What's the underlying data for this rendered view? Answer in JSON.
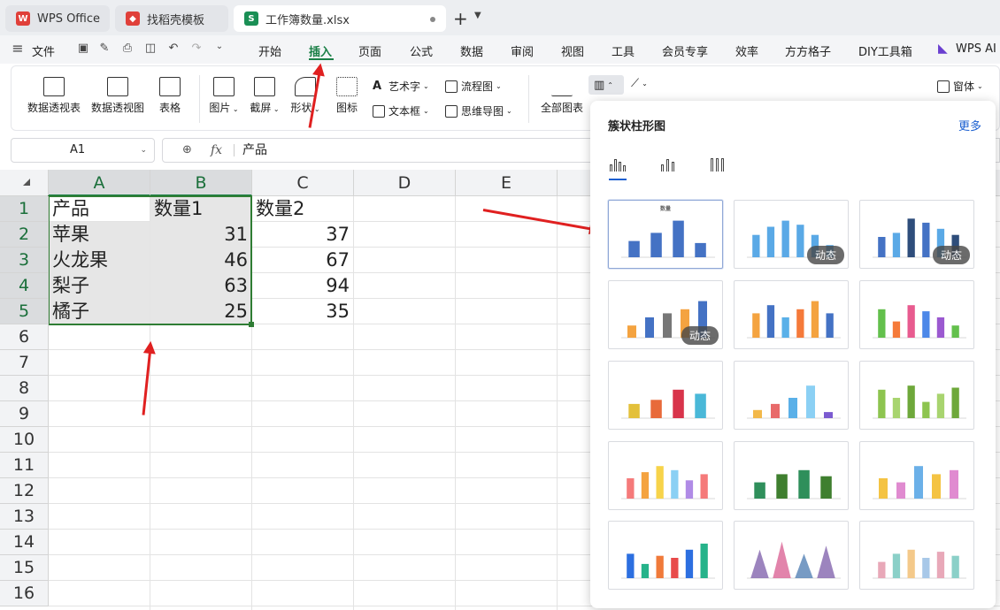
{
  "tabs": [
    {
      "label": "WPS Office",
      "icon": "wps-logo-icon",
      "color": "#e0403a"
    },
    {
      "label": "找稻壳模板",
      "icon": "docer-logo-icon",
      "color": "#e0403a"
    },
    {
      "label": "工作簿数量.xlsx",
      "icon": "sheet-file-icon",
      "color": "#1a8f55"
    }
  ],
  "menu": {
    "file": "文件",
    "items": [
      "开始",
      "插入",
      "页面",
      "公式",
      "数据",
      "审阅",
      "视图",
      "工具",
      "会员专享",
      "效率",
      "方方格子",
      "DIY工具箱"
    ],
    "active": "插入",
    "wps_ai": "WPS AI"
  },
  "ribbon": {
    "pivot_table": "数据透视表",
    "pivot_chart": "数据透视图",
    "table": "表格",
    "picture": "图片",
    "screenshot": "截屏",
    "shape": "形状",
    "icon": "图标",
    "wordart": "艺术字",
    "textbox": "文本框",
    "flowchart": "流程图",
    "mindmap": "思维导图",
    "all_charts": "全部图表",
    "window": "窗体"
  },
  "formula_bar": {
    "cell_ref": "A1",
    "fx": "fx",
    "value": "产品"
  },
  "columns": [
    "A",
    "B",
    "C",
    "D",
    "E"
  ],
  "rows": [
    "1",
    "2",
    "3",
    "4",
    "5",
    "6",
    "7",
    "8",
    "9",
    "10",
    "11",
    "12",
    "13",
    "14",
    "15",
    "16"
  ],
  "sheet": {
    "headers": [
      "产品",
      "数量1",
      "数量2"
    ],
    "data": [
      [
        "苹果",
        "31",
        "37"
      ],
      [
        "火龙果",
        "46",
        "67"
      ],
      [
        "梨子",
        "63",
        "94"
      ],
      [
        "橘子",
        "25",
        "35"
      ]
    ]
  },
  "chart_panel": {
    "title": "簇状柱形图",
    "more": "更多",
    "badge": "动态",
    "thumb1_title": "数量",
    "accent": "#1a5fd0"
  },
  "colors": {
    "accent_green": "#1a7f46",
    "selection": "#2f7d34",
    "arrow": "#e02020"
  }
}
